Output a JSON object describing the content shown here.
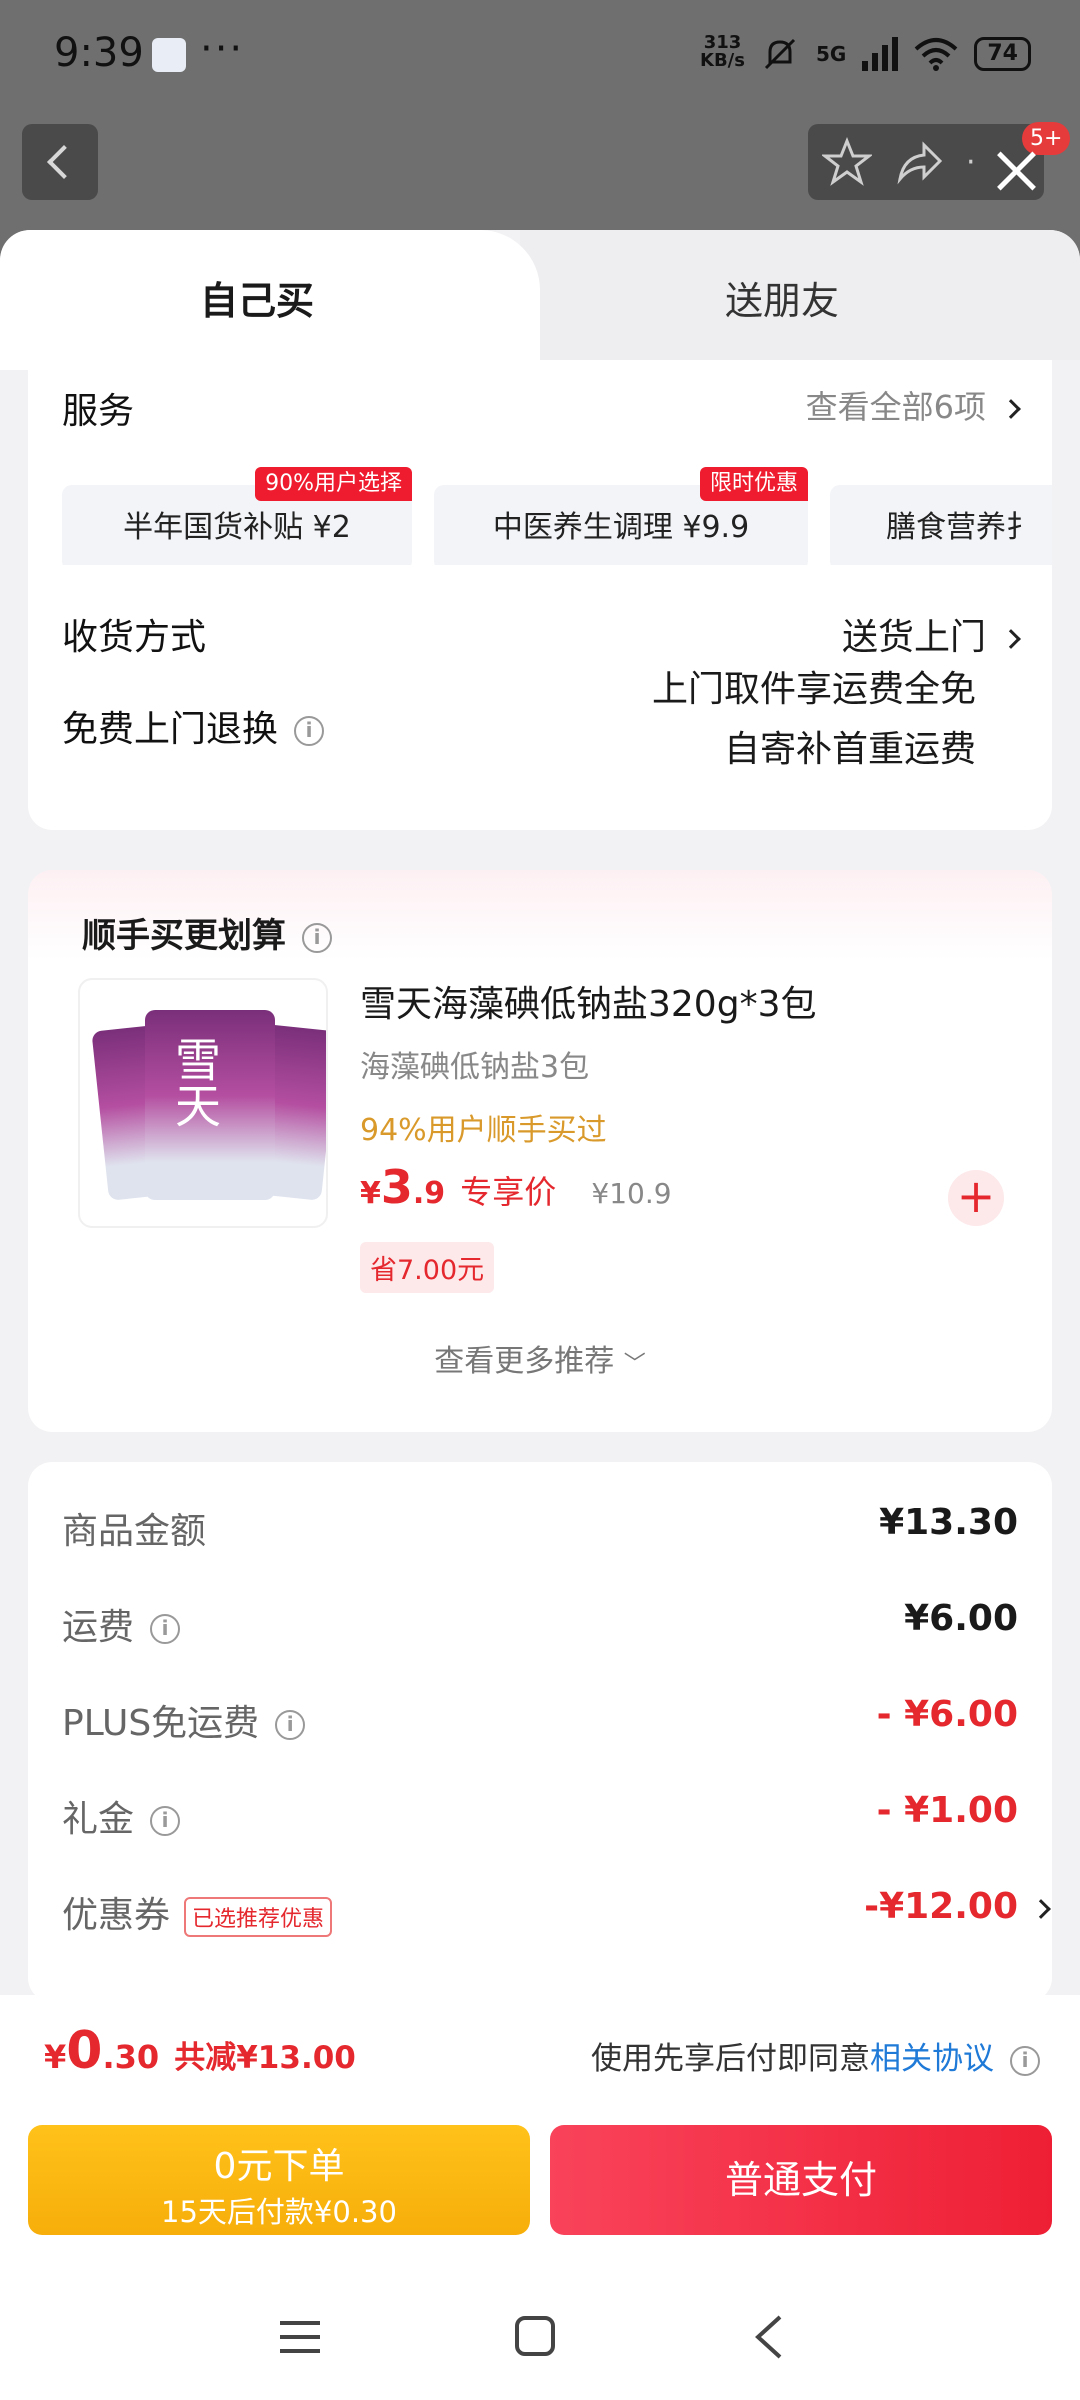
{
  "status": {
    "time": "9:39",
    "dots": "···",
    "speed_value": "313",
    "speed_unit": "KB/s",
    "network": "5G",
    "battery": "74"
  },
  "topbar": {
    "badge": "5+"
  },
  "tabs": {
    "self": "自己买",
    "gift": "送朋友"
  },
  "service": {
    "title": "服务",
    "view_all": "查看全部6项",
    "chips": [
      {
        "label": "半年国货补贴  ¥2",
        "tag": "90%用户选择"
      },
      {
        "label": "中医养生调理  ¥9.9",
        "tag": "限时优惠"
      },
      {
        "label": "膳食营养扌"
      }
    ]
  },
  "delivery": {
    "label": "收货方式",
    "value": "送货上门"
  },
  "return": {
    "label": "免费上门退换",
    "line1": "上门取件享运费全免",
    "line2": "自寄补首重运费"
  },
  "addon": {
    "title": "顺手买更划算",
    "product_name": "雪天海藻碘低钠盐320g*3包",
    "subtitle": "海藻碘低钠盐3包",
    "social": "94%用户顺手买过",
    "currency": "¥",
    "price_int": "3",
    "price_dec": ".9",
    "price_label": "专享价",
    "orig_price": "¥10.9",
    "save": "省7.00元",
    "more": "查看更多推荐",
    "brand_text": "雪天"
  },
  "summary": {
    "rows": [
      {
        "label": "商品金额",
        "value": "¥13.30"
      },
      {
        "label": "运费",
        "value": "¥6.00"
      },
      {
        "label": "PLUS免运费",
        "value": "- ¥6.00"
      },
      {
        "label": "礼金",
        "value": "- ¥1.00"
      },
      {
        "label": "优惠券",
        "tag": "已选推荐优惠",
        "value": "-¥12.00"
      }
    ]
  },
  "paybar": {
    "currency": "¥",
    "total_int": "0",
    "total_dec": ".30",
    "discount": "共减¥13.00",
    "agree_prefix": "使用先享后付即同意",
    "agree_link": "相关协议",
    "btn_later_line1": "0元下单",
    "btn_later_line2": "15天后付款¥0.30",
    "btn_pay": "普通支付"
  },
  "colors": {
    "accent_red": "#e4282e",
    "pay_yellow": "#f9b814",
    "link_blue": "#1e79d7"
  }
}
